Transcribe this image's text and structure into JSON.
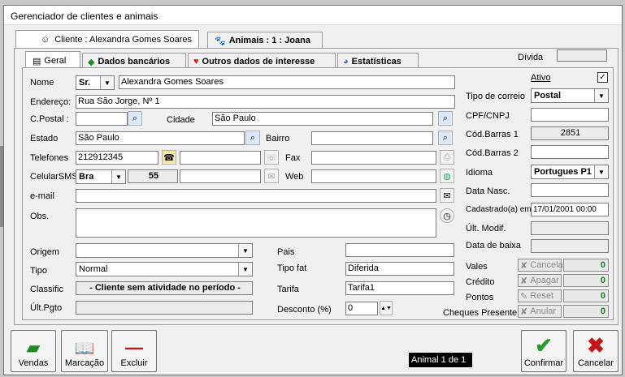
{
  "window": {
    "title": "Gerenciador de clientes e animais"
  },
  "tabs_top": [
    {
      "label": "Cliente : Alexandra Gomes Soares"
    },
    {
      "label": "Animais : 1 : Joana"
    }
  ],
  "tabs_sub": [
    {
      "label": "Geral"
    },
    {
      "label": "Dados bancários"
    },
    {
      "label": "Outros dados de interesse"
    },
    {
      "label": "Estatísticas"
    }
  ],
  "divida_label": "Dívida",
  "form": {
    "nome_label": "Nome",
    "nome_title": "Sr.",
    "nome_value": "Alexandra Gomes Soares",
    "endereco_label": "Endereço:",
    "endereco_value": "Rua São Jorge, Nº 1",
    "cpostal_label": "C.Postal :",
    "cpostal_value": "",
    "cidade_label": "Cidade",
    "cidade_value": "São Paulo",
    "estado_label": "Estado",
    "estado_value": "São Paulo",
    "bairro_label": "Bairro",
    "bairro_value": "",
    "telefones_label": "Telefones",
    "telefones_value": "212912345",
    "fax_label": "Fax",
    "celular_label": "CelularSMS",
    "celular_country": "Bra",
    "celular_code": "55",
    "web_label": "Web",
    "email_label": "e-mail",
    "obs_label": "Obs.",
    "origem_label": "Origem",
    "origem_value": "",
    "tipo_label": "Tipo",
    "tipo_value": "Normal",
    "classific_label": "Classific",
    "classific_value": "- Cliente sem atividade no período -",
    "ultpgto_label": "Últ.Pgto",
    "pais_label": "Pais",
    "tipofat_label": "Tipo fat",
    "tipofat_value": "Diferida",
    "tarifa_label": "Tarifa",
    "tarifa_value": "Tarifa1",
    "desconto_label": "Desconto (%)",
    "desconto_value": "0"
  },
  "right": {
    "ativo_label": "Ativo",
    "ativo_checked": "✓",
    "correio_label": "Tipo de correio",
    "correio_value": "Postal",
    "cpf_label": "CPF/CNPJ",
    "codbarras1_label": "Cód.Barras 1",
    "codbarras1_value": "2851",
    "codbarras2_label": "Cód.Barras 2",
    "idioma_label": "Idioma",
    "idioma_value": "Portugues P1",
    "datanasc_label": "Data Nasc.",
    "cadastrado_label": "Cadastrado(a) em",
    "cadastrado_value": "17/01/2001 00:00",
    "ultmodif_label": "Últ. Modif.",
    "databaixa_label": "Data de baixa"
  },
  "points": [
    {
      "label": "Vales",
      "btn": "Cancela",
      "value": "0"
    },
    {
      "label": "Crédito",
      "btn": "Apagar",
      "value": "0"
    },
    {
      "label": "Pontos",
      "btn": "Reset",
      "value": "0"
    },
    {
      "label": "Cheques Presente",
      "btn": "Anular",
      "value": "0"
    }
  ],
  "bottom": {
    "vendas": "Vendas",
    "marcacao": "Marcação",
    "excluir": "Excluir",
    "status": "Animal 1 de 1",
    "confirmar": "Confirmar",
    "cancelar": "Cancelar"
  },
  "colors": {
    "accent_green": "#1f7a1f",
    "status_bg": "#000000"
  }
}
